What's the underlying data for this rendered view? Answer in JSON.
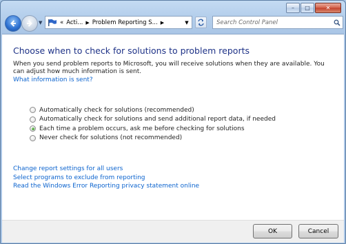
{
  "window": {
    "caption_buttons": {
      "minimize": "–",
      "maximize": "□",
      "close": "✕"
    }
  },
  "navbar": {
    "breadcrumb": [
      "Acti...",
      "Problem Reporting S..."
    ],
    "breadcrumb_prefix": "«",
    "search_placeholder": "Search Control Panel"
  },
  "main": {
    "heading": "Choose when to check for solutions to problem reports",
    "description": "When you send problem reports to Microsoft, you will receive solutions when they are available. You can adjust how much information is sent.",
    "what_info_link": "What information is sent?",
    "options": [
      {
        "label": "Automatically check for solutions (recommended)",
        "checked": false
      },
      {
        "label": "Automatically check for solutions and send additional report data, if needed",
        "checked": false
      },
      {
        "label": "Each time a problem occurs, ask me before checking for solutions",
        "checked": true
      },
      {
        "label": "Never check for solutions (not recommended)",
        "checked": false
      }
    ],
    "links": [
      "Change report settings for all users",
      "Select programs to exclude from reporting",
      "Read the Windows Error Reporting privacy statement online"
    ]
  },
  "footer": {
    "ok_label": "OK",
    "cancel_label": "Cancel"
  },
  "colors": {
    "heading": "#1e3287",
    "link": "#0b63ce",
    "window_frame": "#aac6e6"
  }
}
